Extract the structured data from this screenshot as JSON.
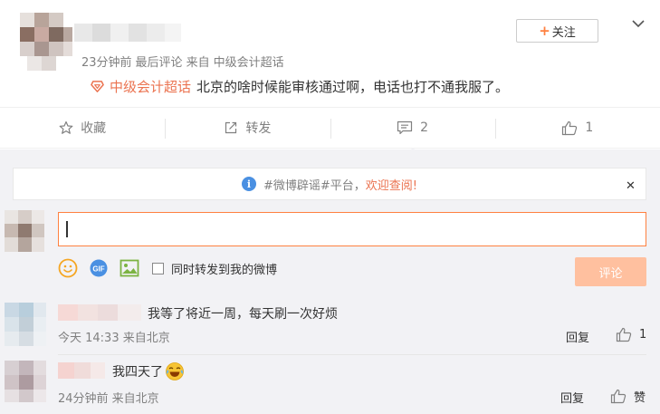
{
  "post": {
    "meta": {
      "time": "23分钟前",
      "source_prefix": "最后评论",
      "from": "来自",
      "from_value": "中级会计超话"
    },
    "topic": "中级会计超话",
    "text": "北京的啥时候能审核通过啊，电话也打不通我服了。",
    "follow_label": "关注"
  },
  "actions": [
    {
      "label": "收藏",
      "icon": "star-icon"
    },
    {
      "label": "转发",
      "icon": "share-icon"
    },
    {
      "label": "2",
      "icon": "comment-icon"
    },
    {
      "label": "1",
      "icon": "thumbs-up-icon"
    }
  ],
  "notice": {
    "prefix": "#微博辟谣#平台，",
    "link": "欢迎查阅!"
  },
  "composer": {
    "input_value": "",
    "repost_label": "同时转发到我的微博",
    "submit_label": "评论",
    "tools": [
      "smile-icon",
      "gif-icon",
      "image-icon"
    ]
  },
  "comments": [
    {
      "text": "我等了将近一周，每天刷一次好烦",
      "meta": "今天 14:33 来自北京",
      "reply": "回复",
      "likes": "1"
    },
    {
      "text": "我四天了",
      "meta": "24分钟前 来自北京",
      "reply": "回复",
      "likes": "赞"
    }
  ],
  "colors": {
    "accent": "#eb7350",
    "button_disabled": "#ffc09f",
    "comment_bg": "#f2f2f5"
  }
}
